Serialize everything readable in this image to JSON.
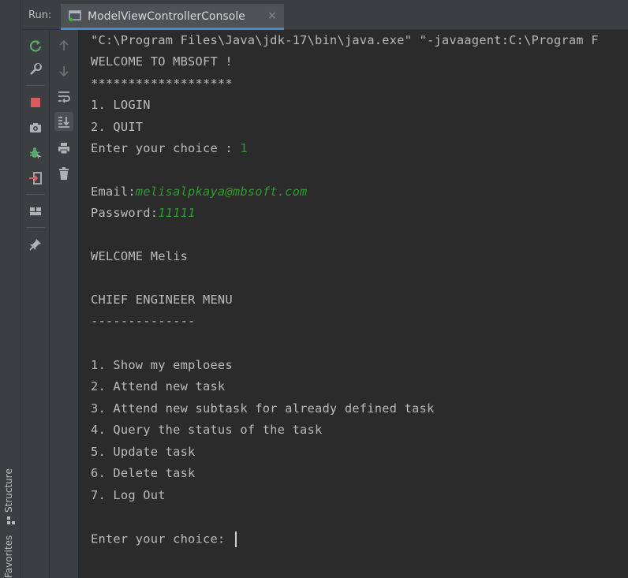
{
  "side_strip": {
    "structure_label": "Structure",
    "favorites_label": "Favorites"
  },
  "header": {
    "run_label": "Run:",
    "tab_title": "ModelViewControllerConsole",
    "tab_close": "×"
  },
  "toolbar_left": {
    "buttons": [
      "rerun-icon",
      "wrench-icon",
      "stop-icon",
      "camera-icon",
      "debug-bug-icon",
      "exit-icon",
      "layout-icon",
      "pin-icon"
    ]
  },
  "toolbar_right": {
    "buttons": [
      "arrow-up-icon",
      "arrow-down-icon",
      "soft-wrap-icon",
      "scroll-to-end-icon",
      "print-icon",
      "trash-icon"
    ]
  },
  "console": {
    "command": "\"C:\\Program Files\\Java\\jdk-17\\bin\\java.exe\" \"-javaagent:C:\\Program F",
    "welcome": "WELCOME TO MBSOFT !",
    "stars": "*******************",
    "menu1": "1. LOGIN",
    "menu2": "2. QUIT",
    "choice_prompt": "Enter your choice : ",
    "choice_value": "1",
    "email_label": "Email:",
    "email_value": "melisalpkaya@mbsoft.com",
    "password_label": "Password:",
    "password_value": "11111",
    "welcome_user": "WELCOME Melis",
    "chief_menu": "CHIEF ENGINEER MENU",
    "dashes": "--------------",
    "options": [
      "1. Show my emploees",
      "2. Attend new task",
      "3. Attend new subtask for already defined task",
      "4. Query the status of the task",
      "5. Update task",
      "6. Delete task",
      "7. Log Out"
    ],
    "final_prompt": "Enter your choice: "
  }
}
